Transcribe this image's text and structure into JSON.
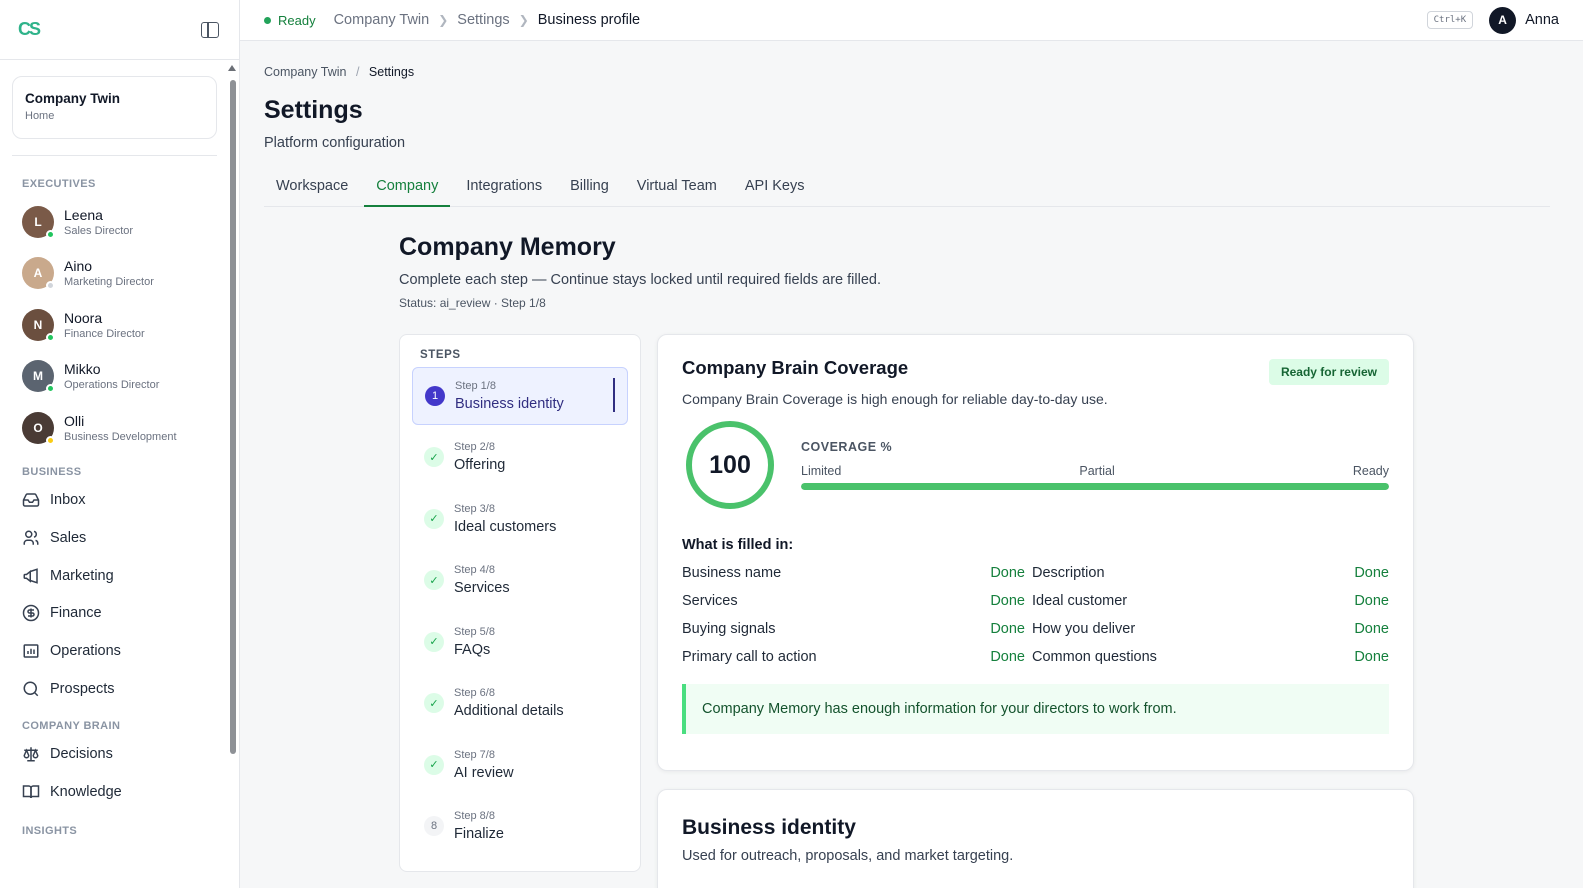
{
  "app": {
    "logo": "CS"
  },
  "sidebar": {
    "company": {
      "name": "Company Twin",
      "sub": "Home"
    },
    "executives_label": "EXECUTIVES",
    "executives": [
      {
        "name": "Leena",
        "role": "Sales Director",
        "initial": "L",
        "avatar_color": "#7a5a48",
        "status_color": "#22c55e"
      },
      {
        "name": "Aino",
        "role": "Marketing Director",
        "initial": "A",
        "avatar_color": "#c9a98c",
        "status_color": "#d1d5db"
      },
      {
        "name": "Noora",
        "role": "Finance Director",
        "initial": "N",
        "avatar_color": "#6b4f3f",
        "status_color": "#22c55e"
      },
      {
        "name": "Mikko",
        "role": "Operations Director",
        "initial": "M",
        "avatar_color": "#5b6470",
        "status_color": "#22c55e"
      },
      {
        "name": "Olli",
        "role": "Business Development",
        "initial": "O",
        "avatar_color": "#4a3b35",
        "status_color": "#facc15"
      }
    ],
    "business_label": "BUSINESS",
    "business_items": [
      {
        "label": "Inbox",
        "icon": "inbox-icon"
      },
      {
        "label": "Sales",
        "icon": "users-icon"
      },
      {
        "label": "Marketing",
        "icon": "megaphone-icon"
      },
      {
        "label": "Finance",
        "icon": "dollar-icon"
      },
      {
        "label": "Operations",
        "icon": "chart-icon"
      },
      {
        "label": "Prospects",
        "icon": "search-icon"
      }
    ],
    "brain_label": "COMPANY BRAIN",
    "brain_items": [
      {
        "label": "Decisions",
        "icon": "scale-icon"
      },
      {
        "label": "Knowledge",
        "icon": "book-icon"
      }
    ],
    "insights_label": "INSIGHTS"
  },
  "topbar": {
    "status": "Ready",
    "crumbs": [
      "Company Twin",
      "Settings",
      "Business profile"
    ],
    "shortcut": "Ctrl+K",
    "user_initial": "A",
    "user_name": "Anna"
  },
  "page": {
    "breadcrumb": [
      "Company Twin",
      "Settings"
    ],
    "title": "Settings",
    "subtitle": "Platform configuration",
    "tabs": [
      "Workspace",
      "Company",
      "Integrations",
      "Billing",
      "Virtual Team",
      "API Keys"
    ],
    "active_tab": "Company"
  },
  "memory": {
    "title": "Company Memory",
    "subtitle": "Complete each step — Continue stays locked until required fields are filled.",
    "status": "Status: ai_review · Step 1/8"
  },
  "steps": {
    "label": "STEPS",
    "items": [
      {
        "num": "Step 1/8",
        "title": "Business identity",
        "state": "active",
        "badge": "1"
      },
      {
        "num": "Step 2/8",
        "title": "Offering",
        "state": "done",
        "badge": "✓"
      },
      {
        "num": "Step 3/8",
        "title": "Ideal customers",
        "state": "done",
        "badge": "✓"
      },
      {
        "num": "Step 4/8",
        "title": "Services",
        "state": "done",
        "badge": "✓"
      },
      {
        "num": "Step 5/8",
        "title": "FAQs",
        "state": "done",
        "badge": "✓"
      },
      {
        "num": "Step 6/8",
        "title": "Additional details",
        "state": "done",
        "badge": "✓"
      },
      {
        "num": "Step 7/8",
        "title": "AI review",
        "state": "done",
        "badge": "✓"
      },
      {
        "num": "Step 8/8",
        "title": "Finalize",
        "state": "todo",
        "badge": "8"
      }
    ]
  },
  "coverage": {
    "title": "Company Brain Coverage",
    "badge": "Ready for review",
    "description": "Company Brain Coverage is high enough for reliable day-to-day use.",
    "score": "100",
    "percent": 100,
    "meter_label": "COVERAGE %",
    "scale": [
      "Limited",
      "Partial",
      "Ready"
    ],
    "filled_title": "What is filled in:",
    "items": [
      {
        "label": "Business name",
        "status": "Done"
      },
      {
        "label": "Description",
        "status": "Done"
      },
      {
        "label": "Services",
        "status": "Done"
      },
      {
        "label": "Ideal customer",
        "status": "Done"
      },
      {
        "label": "Buying signals",
        "status": "Done"
      },
      {
        "label": "How you deliver",
        "status": "Done"
      },
      {
        "label": "Primary call to action",
        "status": "Done"
      },
      {
        "label": "Common questions",
        "status": "Done"
      }
    ],
    "notice": "Company Memory has enough information for your directors to work from."
  },
  "business_identity": {
    "title": "Business identity",
    "subtitle": "Used for outreach, proposals, and market targeting."
  }
}
